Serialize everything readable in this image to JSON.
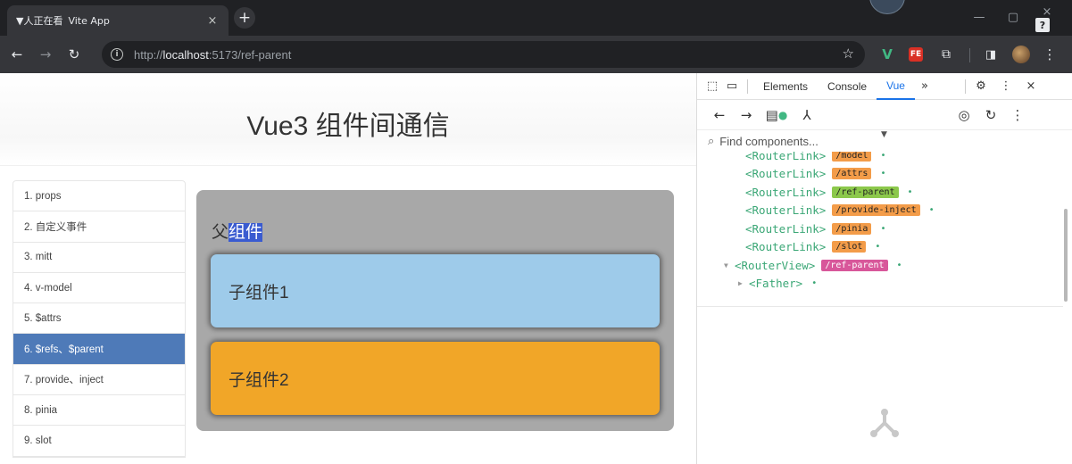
{
  "browser": {
    "tab": {
      "share_label": "▼人正在看",
      "title": "Vite App",
      "close": "×"
    },
    "new_tab": "+",
    "window": {
      "minimize": "—",
      "restore": "▢",
      "close": "×",
      "help": "?"
    },
    "nav": {
      "back": "←",
      "forward": "→",
      "reload": "↻"
    },
    "address": {
      "protocol": "http://",
      "host": "localhost",
      "rest": ":5173/ref-parent"
    },
    "bookmark": "☆",
    "extensions": {
      "vue": "V",
      "fe": "FE",
      "puzzle": "⧉",
      "panel": "◨",
      "more": "⋮"
    }
  },
  "page": {
    "title": "Vue3 组件间通信",
    "menu": [
      {
        "label": "1. props",
        "active": false
      },
      {
        "label": "2. 自定义事件",
        "active": false
      },
      {
        "label": "3. mitt",
        "active": false
      },
      {
        "label": "4. v-model",
        "active": false
      },
      {
        "label": "5. $attrs",
        "active": false
      },
      {
        "label": "6. $refs、$parent",
        "active": true
      },
      {
        "label": "7. provide、inject",
        "active": false
      },
      {
        "label": "8. pinia",
        "active": false
      },
      {
        "label": "9. slot",
        "active": false
      }
    ],
    "father": {
      "prefix": "父",
      "selected": "组件"
    },
    "child1": "子组件1",
    "child2": "子组件2",
    "cursor": "I"
  },
  "devtools": {
    "tabs": {
      "elements": "Elements",
      "console": "Console",
      "vue": "Vue",
      "more": "»"
    },
    "icons": {
      "inspect": "⬚",
      "device": "▭",
      "settings": "⚙",
      "menu": "⋮",
      "close": "×"
    },
    "vue_toolbar": {
      "back": "←",
      "forward": "→",
      "timeline": "▤",
      "tree": "⅄",
      "target": "◎",
      "refresh": "↻",
      "more": "⋮"
    },
    "search": {
      "placeholder": "Find components...",
      "icon": "⌕",
      "caret": "▼"
    },
    "tree": [
      {
        "tag": "<RouterLink>",
        "badge": "/model",
        "color": "orange",
        "arrow": "",
        "indent": 0
      },
      {
        "tag": "<RouterLink>",
        "badge": "/attrs",
        "color": "orange",
        "arrow": "",
        "indent": 0
      },
      {
        "tag": "<RouterLink>",
        "badge": "/ref-parent",
        "color": "green",
        "arrow": "",
        "indent": 0
      },
      {
        "tag": "<RouterLink>",
        "badge": "/provide-inject",
        "color": "orange",
        "arrow": "",
        "indent": 0
      },
      {
        "tag": "<RouterLink>",
        "badge": "/pinia",
        "color": "orange",
        "arrow": "",
        "indent": 0
      },
      {
        "tag": "<RouterLink>",
        "badge": "/slot",
        "color": "orange",
        "arrow": "",
        "indent": 0
      },
      {
        "tag": "<RouterView>",
        "badge": "/ref-parent",
        "color": "pink",
        "arrow": "▼",
        "indent": 0
      },
      {
        "tag": "<Father>",
        "badge": "",
        "color": "",
        "arrow": "▶",
        "indent": 1
      }
    ],
    "dot": "•"
  }
}
